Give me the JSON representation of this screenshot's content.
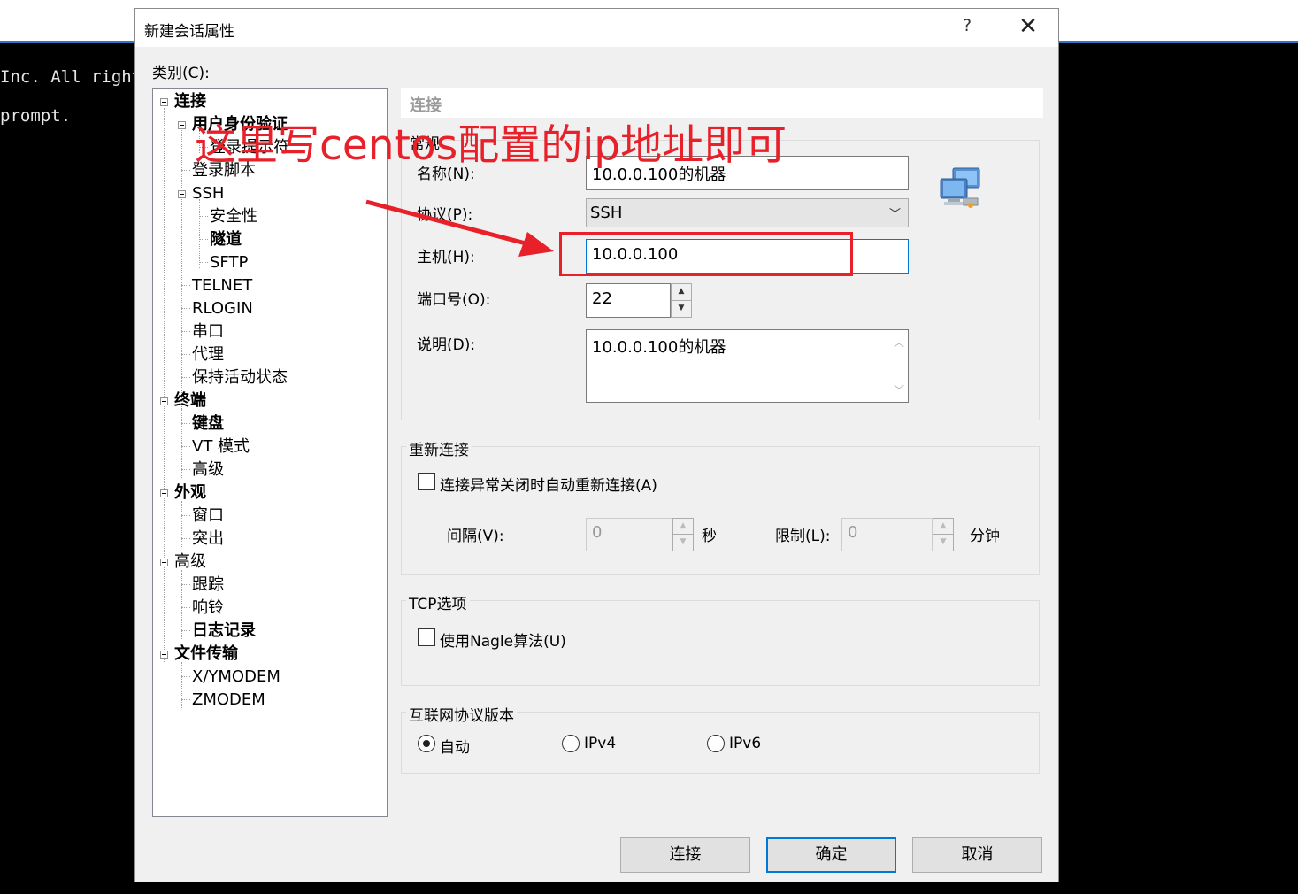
{
  "terminal": {
    "lines": [
      "Inc. All right",
      "prompt."
    ]
  },
  "dialog": {
    "title": "新建会话属性",
    "help_label": "?",
    "close_label": "✕",
    "category_label": "类别(C):"
  },
  "tree": {
    "items": [
      {
        "label": "连接",
        "bold": true
      },
      {
        "label": "用户身份验证",
        "bold": true
      },
      {
        "label": "登录提示符",
        "bold": false
      },
      {
        "label": "登录脚本",
        "bold": false
      },
      {
        "label": "SSH",
        "bold": false
      },
      {
        "label": "安全性",
        "bold": false
      },
      {
        "label": "隧道",
        "bold": true
      },
      {
        "label": "SFTP",
        "bold": false
      },
      {
        "label": "TELNET",
        "bold": false
      },
      {
        "label": "RLOGIN",
        "bold": false
      },
      {
        "label": "串口",
        "bold": false
      },
      {
        "label": "代理",
        "bold": false
      },
      {
        "label": "保持活动状态",
        "bold": false
      },
      {
        "label": "终端",
        "bold": true
      },
      {
        "label": "键盘",
        "bold": true
      },
      {
        "label": "VT 模式",
        "bold": false
      },
      {
        "label": "高级",
        "bold": false
      },
      {
        "label": "外观",
        "bold": true
      },
      {
        "label": "窗口",
        "bold": false
      },
      {
        "label": "突出",
        "bold": false
      },
      {
        "label": "高级",
        "bold": false
      },
      {
        "label": "跟踪",
        "bold": false
      },
      {
        "label": "响铃",
        "bold": false
      },
      {
        "label": "日志记录",
        "bold": true
      },
      {
        "label": "文件传输",
        "bold": true
      },
      {
        "label": "X/YMODEM",
        "bold": false
      },
      {
        "label": "ZMODEM",
        "bold": false
      }
    ]
  },
  "panel": {
    "header": "连接",
    "general": {
      "title": "常规",
      "name_label": "名称(N):",
      "name_value": "10.0.0.100的机器",
      "protocol_label": "协议(P):",
      "protocol_value": "SSH",
      "host_label": "主机(H):",
      "host_value": "10.0.0.100",
      "port_label": "端口号(O):",
      "port_value": "22",
      "desc_label": "说明(D):",
      "desc_value": "10.0.0.100的机器"
    },
    "reconnect": {
      "title": "重新连接",
      "auto_label": "连接异常关闭时自动重新连接(A)",
      "auto_checked": false,
      "interval_label": "间隔(V):",
      "interval_value": "0",
      "interval_unit": "秒",
      "limit_label": "限制(L):",
      "limit_value": "0",
      "limit_unit": "分钟"
    },
    "tcp": {
      "title": "TCP选项",
      "nagle_label": "使用Nagle算法(U)",
      "nagle_checked": false
    },
    "ip_version": {
      "title": "互联网协议版本",
      "options": [
        "自动",
        "IPv4",
        "IPv6"
      ],
      "selected": "自动"
    }
  },
  "buttons": {
    "connect": "连接",
    "ok": "确定",
    "cancel": "取消"
  },
  "annotation": {
    "text": "这里写centos配置的ip地址即可",
    "color": "#e8202a"
  },
  "icons": {
    "session": "network-computers-icon"
  }
}
